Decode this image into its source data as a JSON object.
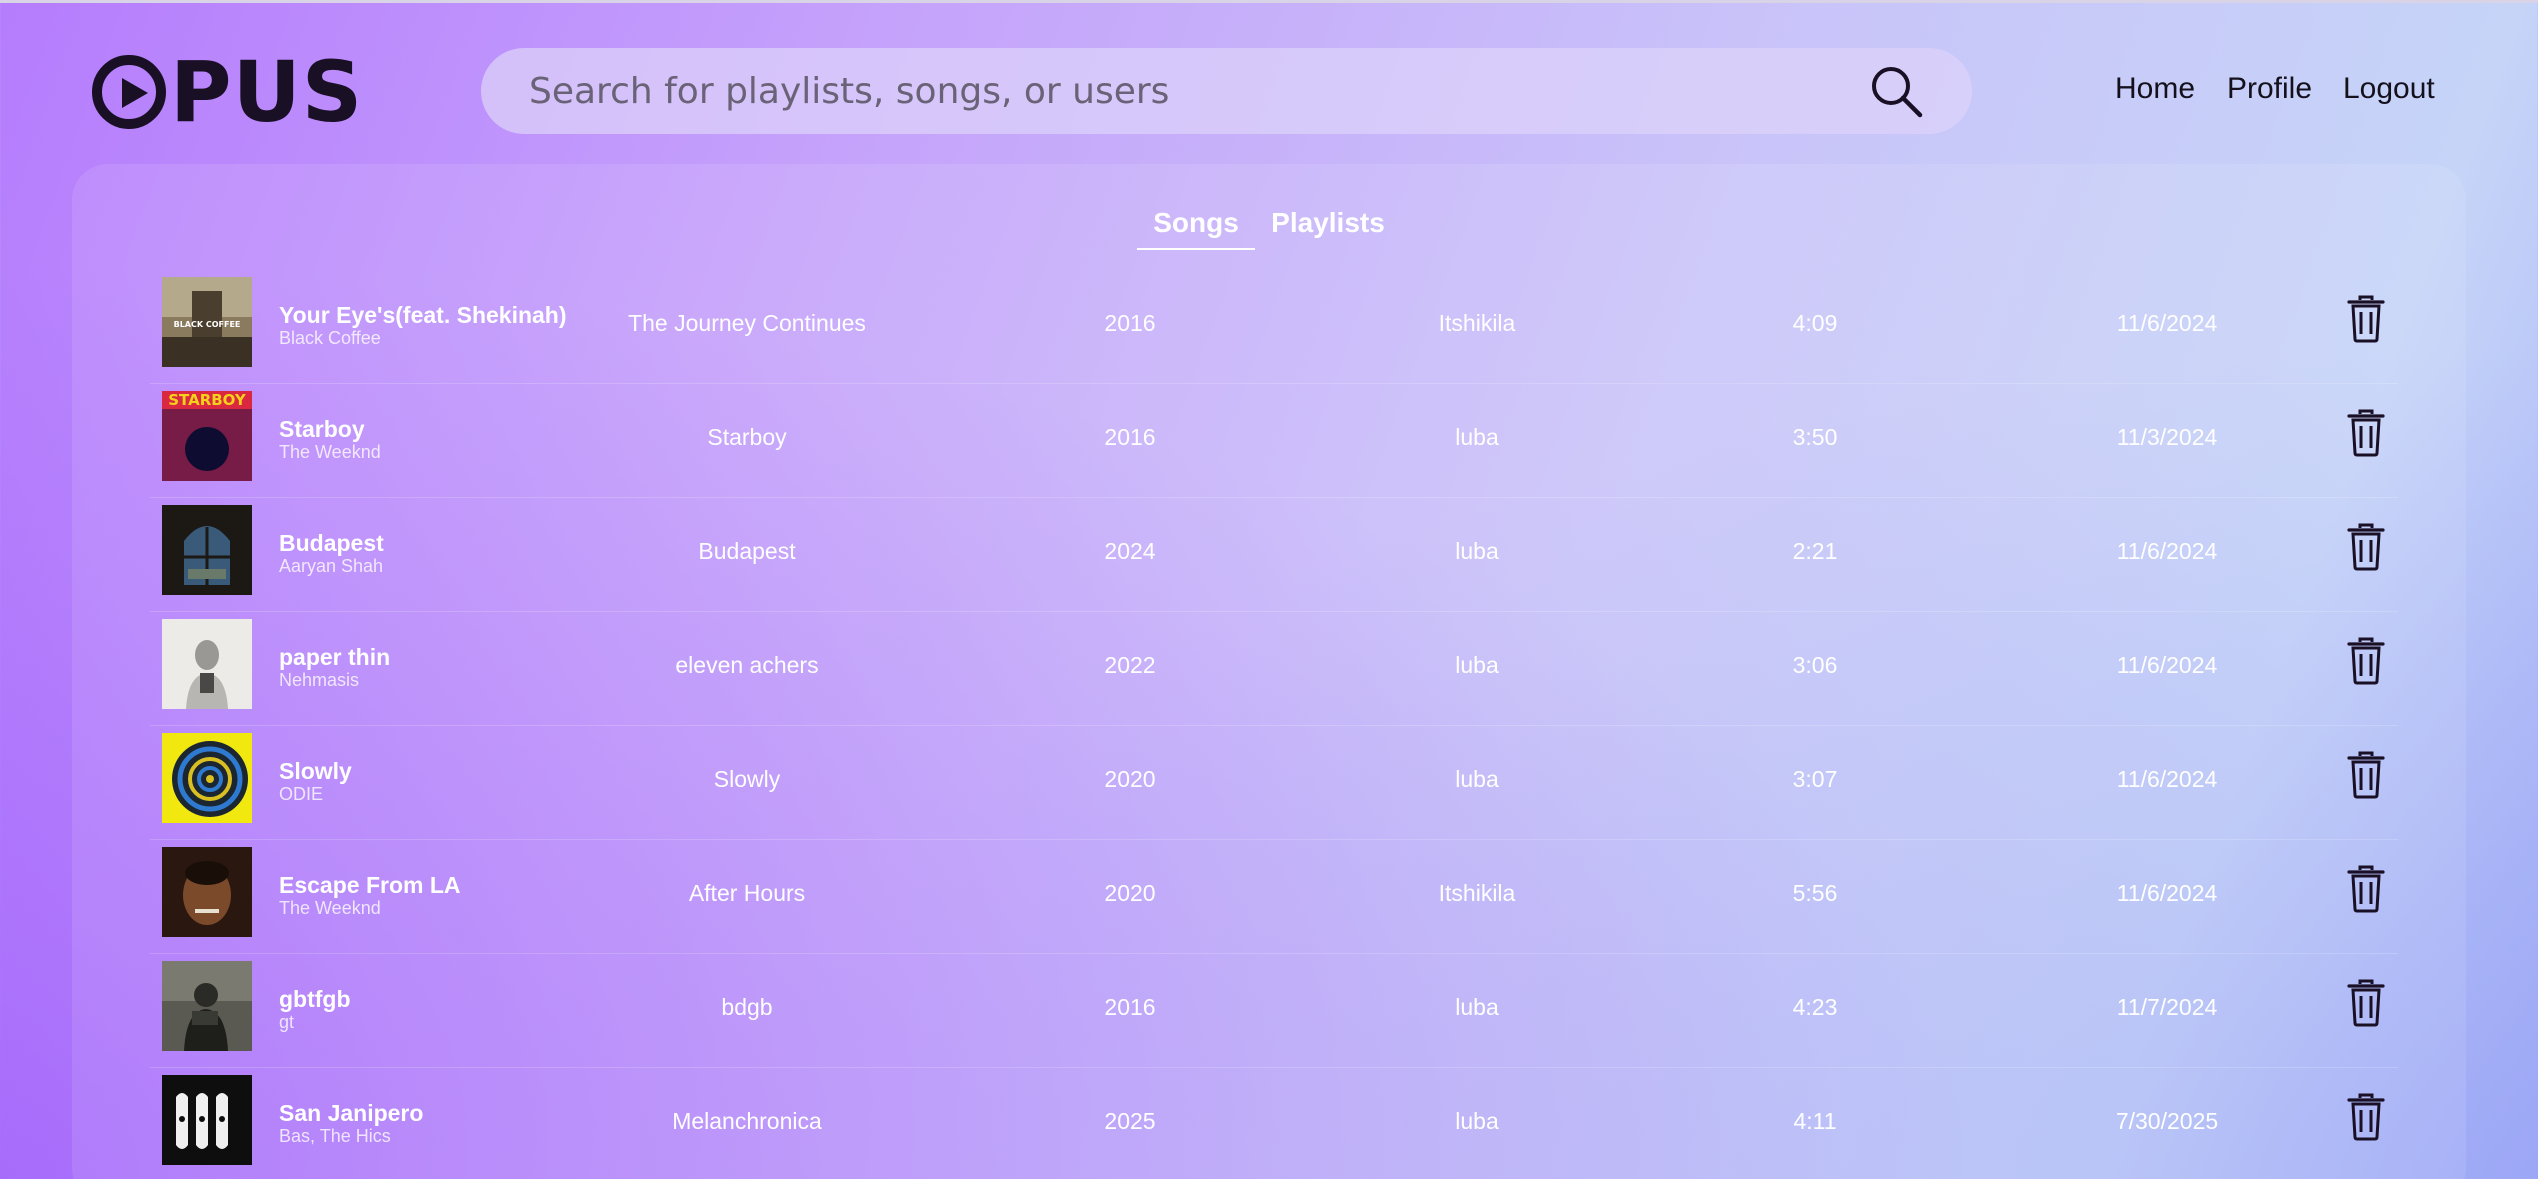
{
  "app": {
    "logo_rest": "PUS"
  },
  "search": {
    "placeholder": "Search for playlists, songs, or users"
  },
  "nav": {
    "home": "Home",
    "profile": "Profile",
    "logout": "Logout"
  },
  "tabs": {
    "songs": "Songs",
    "playlists": "Playlists",
    "active": "Songs"
  },
  "songs": [
    {
      "title": "Your Eye's(feat. Shekinah)",
      "artist": "Black Coffee",
      "album": "The Journey Continues",
      "year": "2016",
      "added_by": "Itshikila",
      "duration": "4:09",
      "date_added": "11/6/2024",
      "cover_label": "BLACK COFFEE"
    },
    {
      "title": "Starboy",
      "artist": "The Weeknd",
      "album": "Starboy",
      "year": "2016",
      "added_by": "luba",
      "duration": "3:50",
      "date_added": "11/3/2024",
      "cover_label": "STARBOY"
    },
    {
      "title": "Budapest",
      "artist": "Aaryan Shah",
      "album": "Budapest",
      "year": "2024",
      "added_by": "luba",
      "duration": "2:21",
      "date_added": "11/6/2024",
      "cover_label": ""
    },
    {
      "title": "paper thin",
      "artist": "Nehmasis",
      "album": "eleven achers",
      "year": "2022",
      "added_by": "luba",
      "duration": "3:06",
      "date_added": "11/6/2024",
      "cover_label": ""
    },
    {
      "title": "Slowly",
      "artist": "ODIE",
      "album": "Slowly",
      "year": "2020",
      "added_by": "luba",
      "duration": "3:07",
      "date_added": "11/6/2024",
      "cover_label": ""
    },
    {
      "title": "Escape From LA",
      "artist": "The Weeknd",
      "album": "After Hours",
      "year": "2020",
      "added_by": "Itshikila",
      "duration": "5:56",
      "date_added": "11/6/2024",
      "cover_label": ""
    },
    {
      "title": "gbtfgb",
      "artist": "gt",
      "album": "bdgb",
      "year": "2016",
      "added_by": "luba",
      "duration": "4:23",
      "date_added": "11/7/2024",
      "cover_label": ""
    },
    {
      "title": "San Janipero",
      "artist": "Bas, The Hics",
      "album": "Melanchronica",
      "year": "2025",
      "added_by": "luba",
      "duration": "4:11",
      "date_added": "7/30/2025",
      "cover_label": ""
    }
  ],
  "colors": {
    "accent_text": "#ffffff",
    "logo": "#1a1026"
  },
  "icons": {
    "search": "search-icon",
    "delete": "trash-icon"
  }
}
